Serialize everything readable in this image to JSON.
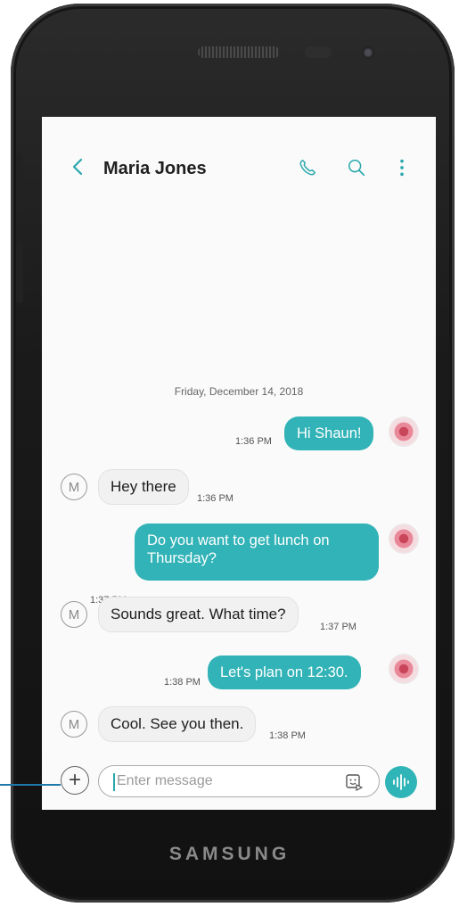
{
  "device": {
    "brand": "SAMSUNG"
  },
  "header": {
    "back_icon": "chevron-left-icon",
    "contact_name": "Maria Jones",
    "icons": [
      "phone-icon",
      "search-icon",
      "more-vertical-icon"
    ]
  },
  "conversation": {
    "date_separator": "Friday, December 14, 2018",
    "messages": [
      {
        "direction": "outgoing",
        "text": "Hi Shaun!",
        "time": "1:36 PM"
      },
      {
        "direction": "incoming",
        "avatar": "M",
        "text": "Hey there",
        "time": "1:36 PM"
      },
      {
        "direction": "outgoing",
        "text_line1": "Do you want to get lunch on",
        "text_line2": "Thursday?",
        "time": "1:37 PM"
      },
      {
        "direction": "incoming",
        "avatar": "M",
        "text": "Sounds great. What time?",
        "time": "1:37 PM"
      },
      {
        "direction": "outgoing",
        "text": "Let's plan on 12:30.",
        "time": "1:38 PM"
      },
      {
        "direction": "incoming",
        "avatar": "M",
        "text": "Cool. See you then.",
        "time": "1:38 PM"
      }
    ]
  },
  "composer": {
    "add_icon": "plus-icon",
    "placeholder": "Enter message",
    "sticker_icon": "sticker-icon",
    "send_icon": "voice-send-icon"
  },
  "colors": {
    "accent": "#32b3b7",
    "incoming_bubble": "#f1f1f1"
  }
}
